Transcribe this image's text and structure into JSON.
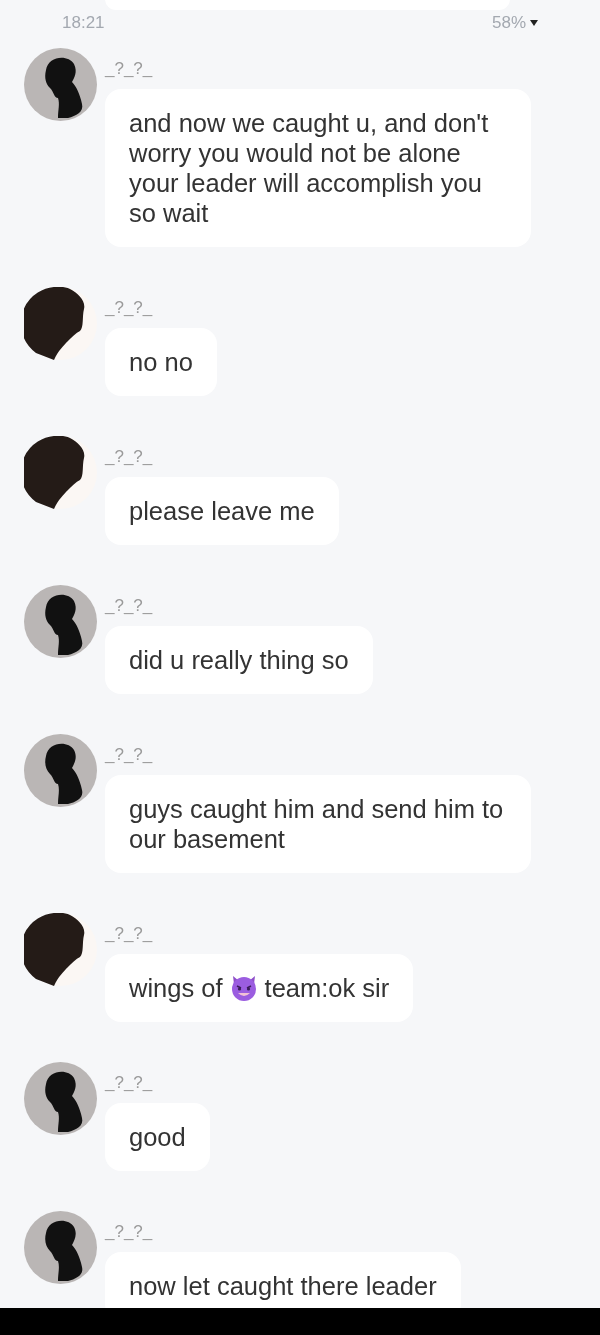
{
  "status_bar": {
    "time": "18:21",
    "battery": "58%"
  },
  "messages": [
    {
      "name": "_?_?_",
      "kind": "grey",
      "text": "and now we caught u, and don't worry you would not be alone your leader will accomplish you so wait"
    },
    {
      "name": "_?_?_",
      "kind": "dark",
      "text": "no no"
    },
    {
      "name": "_?_?_",
      "kind": "dark",
      "text": "please leave me"
    },
    {
      "name": "_?_?_",
      "kind": "grey",
      "text": "did u really thing so"
    },
    {
      "name": "_?_?_",
      "kind": "grey",
      "text": "guys caught him and send him to our basement"
    },
    {
      "name": "_?_?_",
      "kind": "dark",
      "segments": [
        {
          "kind": "text",
          "text": "wings of"
        },
        {
          "kind": "emoji"
        },
        {
          "kind": "text",
          "text": "team:ok sir"
        }
      ]
    },
    {
      "name": "_?_?_",
      "kind": "grey",
      "text": "good"
    },
    {
      "name": "_?_?_",
      "kind": "grey",
      "text": "now let caught there leader"
    }
  ]
}
